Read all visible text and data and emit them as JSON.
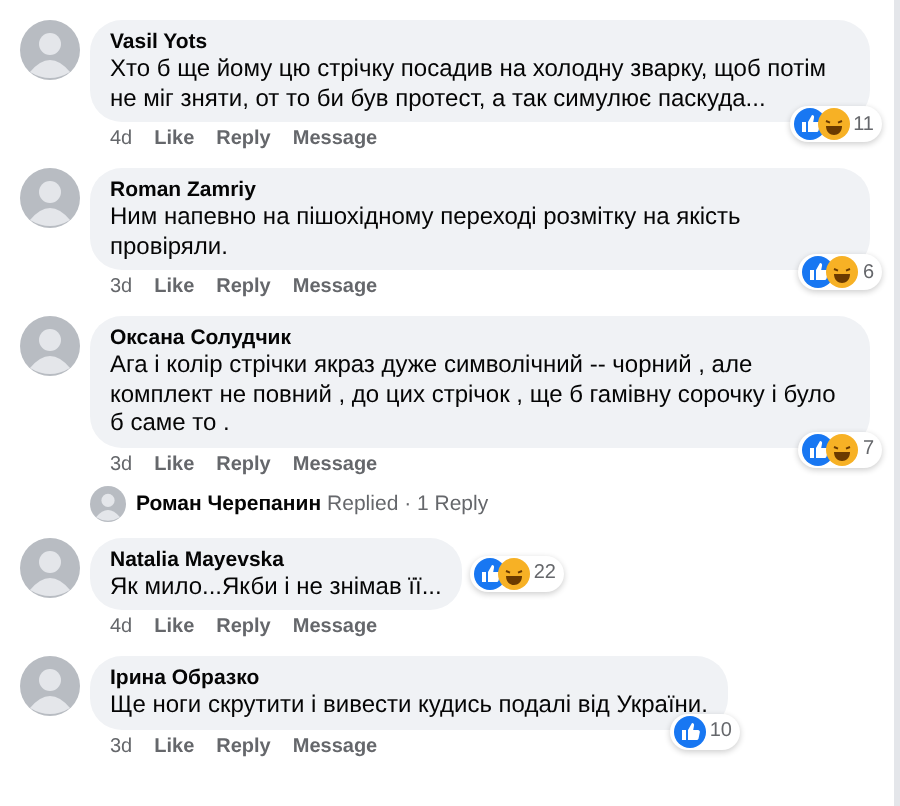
{
  "comments": [
    {
      "author": "Vasil Yots",
      "text": "Хто б ще йому цю стрічку посадив на холодну зварку, щоб потім не міг зняти, от то би був протест, а так симулює паскуда...",
      "reactions": [
        {
          "kind": "like"
        },
        {
          "kind": "haha"
        }
      ],
      "reaction_count": "11",
      "reactions_inline": false,
      "time": "4d",
      "actions": [
        "Like",
        "Reply",
        "Message"
      ]
    },
    {
      "author": "Roman Zamriy",
      "text": "Ним напевно на пішохідному переході розмітку на якість провіряли.",
      "reactions": [
        {
          "kind": "like"
        },
        {
          "kind": "haha"
        }
      ],
      "reaction_count": "6",
      "reactions_inline": false,
      "time": "3d",
      "actions": [
        "Like",
        "Reply",
        "Message"
      ]
    },
    {
      "author": "Оксана Солудчик",
      "text": "Ага і колір стрічки якраз дуже символічний -- чорний , але комплект не повний , до цих стрічок , ще б гамівну сорочку  і було б саме то .",
      "reactions": [
        {
          "kind": "like"
        },
        {
          "kind": "haha"
        }
      ],
      "reaction_count": "7",
      "reactions_inline": false,
      "time": "3d",
      "actions": [
        "Like",
        "Reply",
        "Message"
      ],
      "replies": {
        "author": "Роман Черепанин",
        "status": "Replied",
        "separator": "·",
        "count": "1 Reply"
      }
    },
    {
      "author": "Natalia Mayevska",
      "text": "Як мило...Якби і не знімав її...",
      "reactions": [
        {
          "kind": "like"
        },
        {
          "kind": "haha"
        }
      ],
      "reaction_count": "22",
      "reactions_inline": true,
      "time": "4d",
      "actions": [
        "Like",
        "Reply",
        "Message"
      ]
    },
    {
      "author": "Ірина Образко",
      "text": "Ще ноги скрутити і вивести кудись подалі від України.",
      "reactions": [
        {
          "kind": "like"
        }
      ],
      "reaction_count": "10",
      "reactions_inline": false,
      "time": "3d",
      "actions": [
        "Like",
        "Reply",
        "Message"
      ]
    }
  ]
}
